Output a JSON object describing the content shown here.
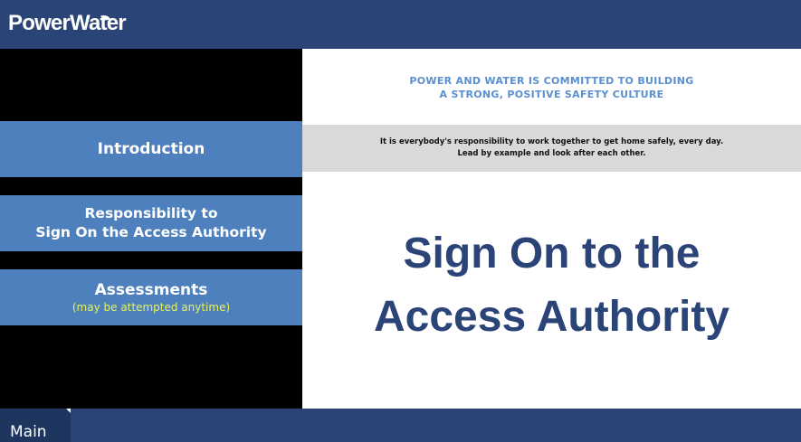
{
  "header": {
    "logo_text": "PowerWater"
  },
  "sidebar": {
    "items": [
      {
        "label": "Introduction"
      },
      {
        "label_line1": "Responsibility to",
        "label_line2": "Sign On the Access Authority"
      },
      {
        "label": "Assessments",
        "sublabel": "(may be attempted anytime)"
      }
    ]
  },
  "content": {
    "commitment_line1": "POWER AND WATER IS COMMITTED TO BUILDING",
    "commitment_line2": "A STRONG, POSITIVE SAFETY CULTURE",
    "band_line1": "It is everybody's responsibility to work together to get home safely, every day.",
    "band_line2": "Lead by example and look after each other.",
    "title_line1": "Sign On to the",
    "title_line2": "Access Authority"
  },
  "footer": {
    "tab_label": "Main"
  },
  "colors": {
    "brand_navy": "#2b4477",
    "nav_blue": "#4f80be",
    "accent_blue": "#5a8fd0",
    "sublabel_yellow": "#e6f25c",
    "band_grey": "#d9d9d9"
  }
}
